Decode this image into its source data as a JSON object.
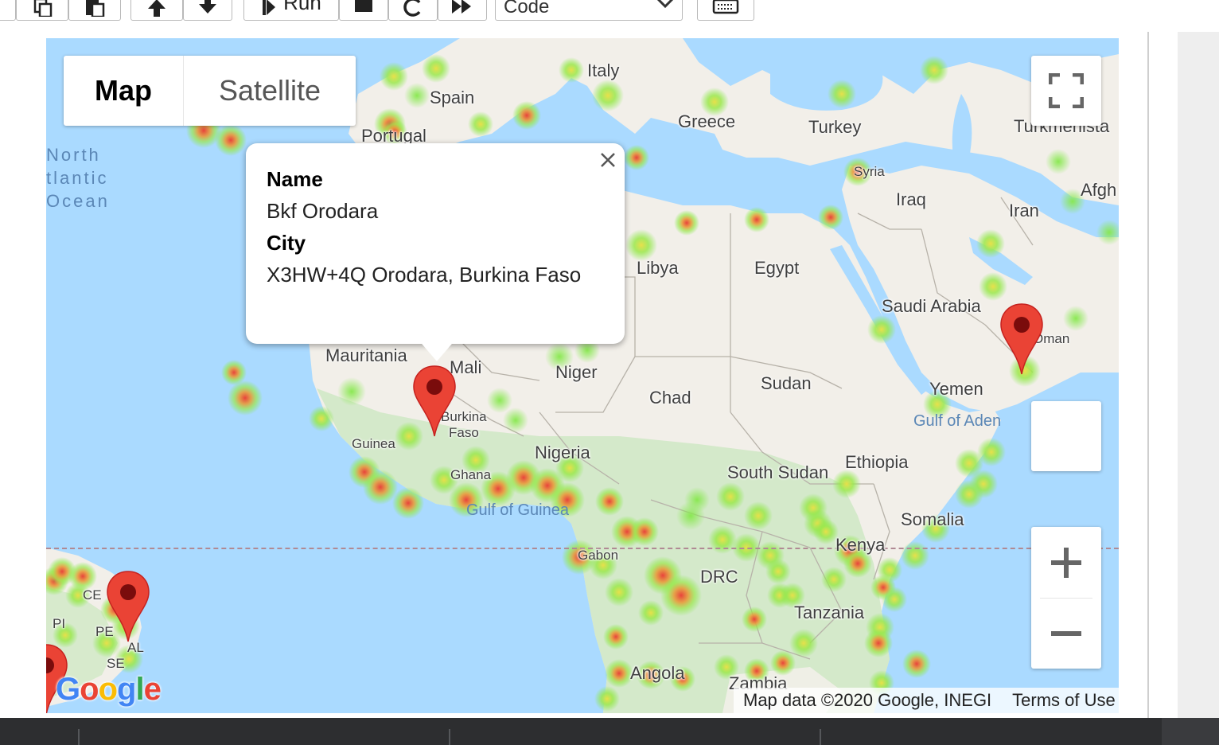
{
  "toolbar": {
    "run_label": "Run",
    "cell_type_selected": "Code",
    "buttons": [
      "copy-icon",
      "paste-icon",
      "move-up-icon",
      "move-down-icon",
      "run-icon",
      "stop-icon",
      "restart-icon",
      "fast-forward-icon",
      "keyboard-icon"
    ]
  },
  "map": {
    "map_type": {
      "map_label": "Map",
      "satellite_label": "Satellite",
      "selected": "Map"
    },
    "countries": [
      "Italy",
      "Spain",
      "Portugal",
      "Greece",
      "Turkey",
      "Syria",
      "Iraq",
      "Iran",
      "Afgh",
      "Turkmenista",
      "Libya",
      "Egypt",
      "Saudi Arabia",
      "Oman",
      "Yemen",
      "Mauritania",
      "Mali",
      "Niger",
      "Chad",
      "Sudan",
      "Burkina",
      "Faso",
      "Guinea",
      "Ghana",
      "Nigeria",
      "South Sudan",
      "Ethiopia",
      "Somalia",
      "Kenya",
      "Gabon",
      "DRC",
      "Tanzania",
      "Angola",
      "Zambia"
    ],
    "brazil_states": [
      "CE",
      "PI",
      "PE",
      "AL",
      "SE"
    ],
    "water_labels": [
      "North",
      "tlantic",
      "Ocean",
      "Gulf of Aden",
      "Gulf of Guinea"
    ],
    "info_window": {
      "name_heading": "Name",
      "name_value": "Bkf Orodara",
      "city_heading": "City",
      "city_value": "X3HW+4Q Orodara, Burkina Faso"
    },
    "markers": [
      "Bkf Orodara",
      "Oman marker",
      "Brazil marker",
      "Brazil marker 2"
    ],
    "attribution": "Map data ©2020 Google, INEGI",
    "terms_label": "Terms of Use",
    "logo_text": "Google",
    "controls": [
      "fullscreen-icon",
      "zoom-in-icon",
      "zoom-out-icon"
    ],
    "colors": {
      "water": "#aadaff",
      "land": "#f2efe9",
      "vegetation": "#cfe8c4",
      "heat_low": "#86e84c",
      "heat_high": "#e8433b",
      "marker": "#ea4335"
    }
  }
}
